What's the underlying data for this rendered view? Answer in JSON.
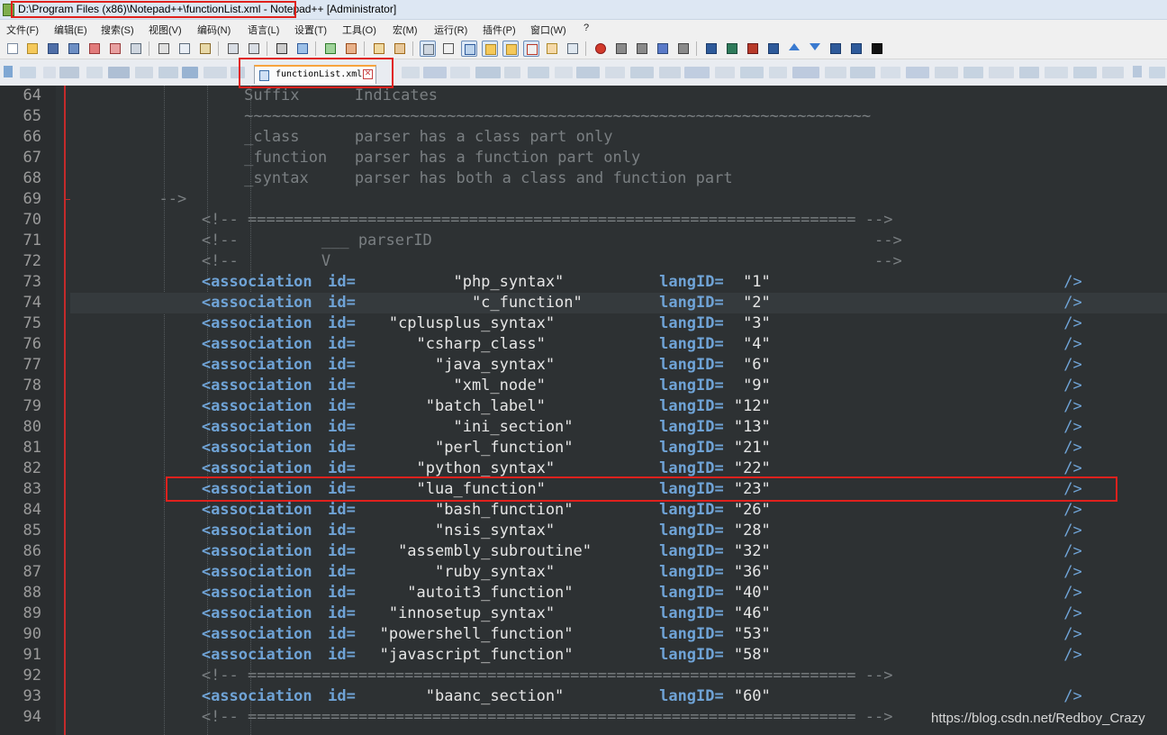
{
  "window": {
    "title": "D:\\Program Files (x86)\\Notepad++\\functionList.xml - Notepad++ [Administrator]"
  },
  "menu": [
    "文件(F)",
    "编辑(E)",
    "搜索(S)",
    "视图(V)",
    "编码(N)",
    "语言(L)",
    "设置(T)",
    "工具(O)",
    "宏(M)",
    "运行(R)",
    "插件(P)",
    "窗口(W)",
    "?"
  ],
  "tab": {
    "label": "functionList.xml",
    "close_icon": "close-icon"
  },
  "editor": {
    "lines": [
      {
        "n": "64",
        "tokens": [
          {
            "t": "Suffix      Indicates",
            "c": "com",
            "col": 16
          }
        ]
      },
      {
        "n": "65",
        "tokens": [
          {
            "t": "~~~~~~~~~~~~~~~~~~~~~~~~~~~~~~~~~~~~~~~~~~~~~~~~~~~~~~~~~~~~~~~~~~~~",
            "c": "com",
            "col": 16
          }
        ]
      },
      {
        "n": "66",
        "tokens": [
          {
            "t": "_class      parser has a class part only",
            "c": "com",
            "col": 16
          }
        ]
      },
      {
        "n": "67",
        "tokens": [
          {
            "t": "_function   parser has a function part only",
            "c": "com",
            "col": 16
          }
        ]
      },
      {
        "n": "68",
        "tokens": [
          {
            "t": "_syntax     parser has both a class and function part",
            "c": "com",
            "col": 16
          }
        ]
      },
      {
        "n": "69",
        "tokens": [
          {
            "t": "-->",
            "c": "com",
            "col": 8
          }
        ]
      },
      {
        "n": "70",
        "tokens": [
          {
            "t": "<!-- ================================================================== -->",
            "c": "com",
            "col": 12
          }
        ]
      },
      {
        "n": "71",
        "tokens": [
          {
            "t": "<!--         ___ parserID                                                -->",
            "c": "com",
            "col": 12
          }
        ]
      },
      {
        "n": "72",
        "tokens": [
          {
            "t": "<!--         V                                                           -->",
            "c": "com",
            "col": 12
          }
        ]
      },
      {
        "n": "73",
        "assoc": true,
        "id": "          \"php_syntax\"     ",
        "lang": " \"1\"",
        "gap": "                     "
      },
      {
        "n": "74",
        "assoc": true,
        "id": "            \"c_function\"   ",
        "lang": " \"2\"",
        "gap": "                     "
      },
      {
        "n": "75",
        "assoc": true,
        "id": "   \"cplusplus_syntax\"     ",
        "lang": " \"3\"",
        "gap": "                     "
      },
      {
        "n": "76",
        "assoc": true,
        "id": "      \"csharp_class\"      ",
        "lang": " \"4\"",
        "gap": "                     "
      },
      {
        "n": "77",
        "assoc": true,
        "id": "        \"java_syntax\"     ",
        "lang": " \"6\"",
        "gap": "                     "
      },
      {
        "n": "78",
        "assoc": true,
        "id": "          \"xml_node\"      ",
        "lang": " \"9\"",
        "gap": "                     "
      },
      {
        "n": "79",
        "assoc": true,
        "id": "       \"batch_label\"      ",
        "lang": "\"12\"",
        "gap": "                     "
      },
      {
        "n": "80",
        "assoc": true,
        "id": "          \"ini_section\"    ",
        "lang": "\"13\"",
        "gap": "                     "
      },
      {
        "n": "81",
        "assoc": true,
        "id": "        \"perl_function\"   ",
        "lang": "\"21\"",
        "gap": "                     "
      },
      {
        "n": "82",
        "assoc": true,
        "id": "      \"python_syntax\"     ",
        "lang": "\"22\"",
        "gap": "                     "
      },
      {
        "n": "83",
        "assoc": true,
        "id": "      \"lua_function\"      ",
        "lang": "\"23\"",
        "gap": "                     "
      },
      {
        "n": "84",
        "assoc": true,
        "id": "        \"bash_function\"   ",
        "lang": "\"26\"",
        "gap": "                     "
      },
      {
        "n": "85",
        "assoc": true,
        "id": "        \"nsis_syntax\"     ",
        "lang": "\"28\"",
        "gap": "                     "
      },
      {
        "n": "86",
        "assoc": true,
        "id": "    \"assembly_subroutine\" ",
        "lang": "\"32\"",
        "gap": "                     "
      },
      {
        "n": "87",
        "assoc": true,
        "id": "        \"ruby_syntax\"     ",
        "lang": "\"36\"",
        "gap": "                     "
      },
      {
        "n": "88",
        "assoc": true,
        "id": "     \"autoit3_function\"   ",
        "lang": "\"40\"",
        "gap": "                     "
      },
      {
        "n": "89",
        "assoc": true,
        "id": "   \"innosetup_syntax\"     ",
        "lang": "\"46\"",
        "gap": "                     "
      },
      {
        "n": "90",
        "assoc": true,
        "id": "  \"powershell_function\"   ",
        "lang": "\"53\"",
        "gap": "                     "
      },
      {
        "n": "91",
        "assoc": true,
        "id": "  \"javascript_function\"   ",
        "lang": "\"58\"",
        "gap": "                     "
      },
      {
        "n": "92",
        "tokens": [
          {
            "t": "<!-- ================================================================== -->",
            "c": "com",
            "col": 12
          }
        ]
      },
      {
        "n": "93",
        "assoc": true,
        "id": "       \"baanc_section\"    ",
        "lang": "\"60\"",
        "gap": "                     "
      },
      {
        "n": "94",
        "tokens": [
          {
            "t": "<!-- ================================================================== -->",
            "c": "com",
            "col": 12
          }
        ]
      }
    ],
    "assoc_tag": "<association",
    "id_attr": " id=",
    "lang_attr": "langID=",
    "end_tag": "/>",
    "current_line": "74",
    "highlighted_line": "83"
  },
  "watermark": "https://blog.csdn.net/Redboy_Crazy",
  "colors": {
    "editor_bg": "#2d3133",
    "comment": "#7a7f82",
    "tag": "#6fa3d6",
    "string": "#e6e6e6",
    "annotation_box": "#e0211d"
  }
}
